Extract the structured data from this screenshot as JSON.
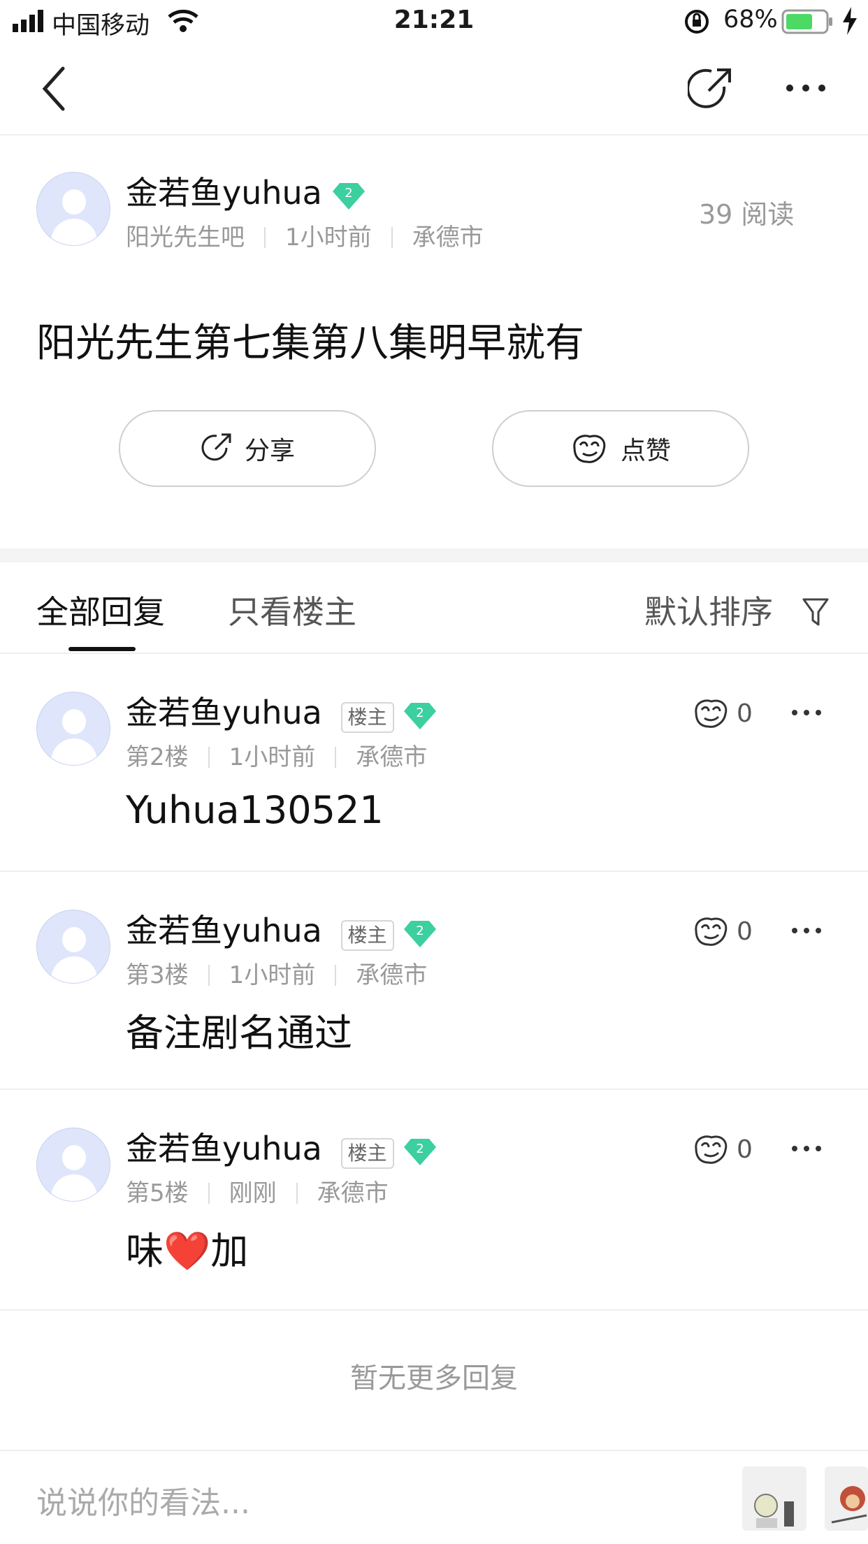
{
  "status_bar": {
    "carrier": "中国移动",
    "time": "21:21",
    "battery": "68%"
  },
  "post": {
    "author": "金若鱼yuhua",
    "level": "2",
    "forum": "阳光先生吧",
    "time": "1小时前",
    "location": "承德市",
    "read_count": "39 阅读",
    "title": "阳光先生第七集第八集明早就有",
    "share_label": "分享",
    "like_label": "点赞"
  },
  "tabs": {
    "all_replies": "全部回复",
    "owner_only": "只看楼主",
    "sort": "默认排序"
  },
  "replies": [
    {
      "author": "金若鱼yuhua",
      "badge": "楼主",
      "level": "2",
      "floor": "第2楼",
      "time": "1小时前",
      "location": "承德市",
      "likes": "0",
      "text": "Yuhua130521"
    },
    {
      "author": "金若鱼yuhua",
      "badge": "楼主",
      "level": "2",
      "floor": "第3楼",
      "time": "1小时前",
      "location": "承德市",
      "likes": "0",
      "text": "备注剧名通过"
    },
    {
      "author": "金若鱼yuhua",
      "badge": "楼主",
      "level": "2",
      "floor": "第5楼",
      "time": "刚刚",
      "location": "承德市",
      "likes": "0",
      "text": "味❤️加"
    }
  ],
  "no_more": "暂无更多回复",
  "comment_placeholder": "说说你的看法...",
  "colors": {
    "accent": "#1a1a1a",
    "gem": "#3ccfa0",
    "battery": "#4cd964",
    "avatar_bg": "#dfe6fb"
  }
}
